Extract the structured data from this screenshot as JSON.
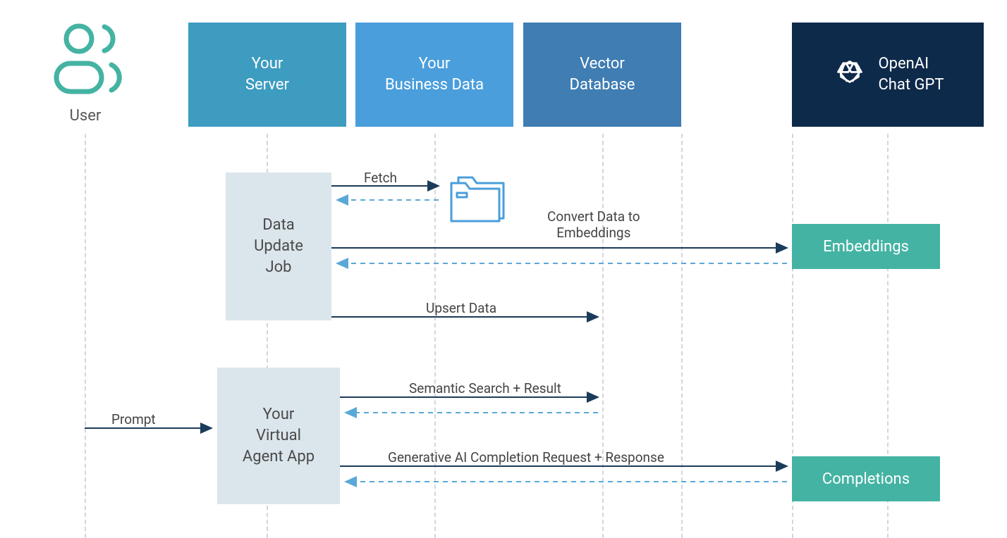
{
  "lanes": {
    "user": {
      "label": "User"
    },
    "server": {
      "label": "Your\nServer"
    },
    "business": {
      "label": "Your\nBusiness Data"
    },
    "vector": {
      "label": "Vector\nDatabase"
    },
    "openai": {
      "label1": "OpenAI",
      "label2": "Chat GPT"
    }
  },
  "activations": {
    "dataJob": {
      "line1": "Data",
      "line2": "Update",
      "line3": "Job"
    },
    "agentApp": {
      "line1": "Your",
      "line2": "Virtual",
      "line3": "Agent App"
    }
  },
  "api": {
    "embeddings": "Embeddings",
    "completions": "Completions"
  },
  "arrows": {
    "fetch": "Fetch",
    "convert": {
      "line1": "Convert Data to",
      "line2": "Embeddings"
    },
    "upsert": "Upsert Data",
    "prompt": "Prompt",
    "semantic": "Semantic Search + Result",
    "generative": "Generative AI Completion Request + Response"
  },
  "colors": {
    "teal": "#44b3a3",
    "serverBlue": "#3d9cc0",
    "bizBlue": "#4a9edb",
    "vectorBlue": "#3f7db3",
    "navy": "#0e2a4a",
    "activation": "#dbe5ec",
    "lineDark": "#1b3b5a",
    "lineLight": "#5aa8d8"
  }
}
